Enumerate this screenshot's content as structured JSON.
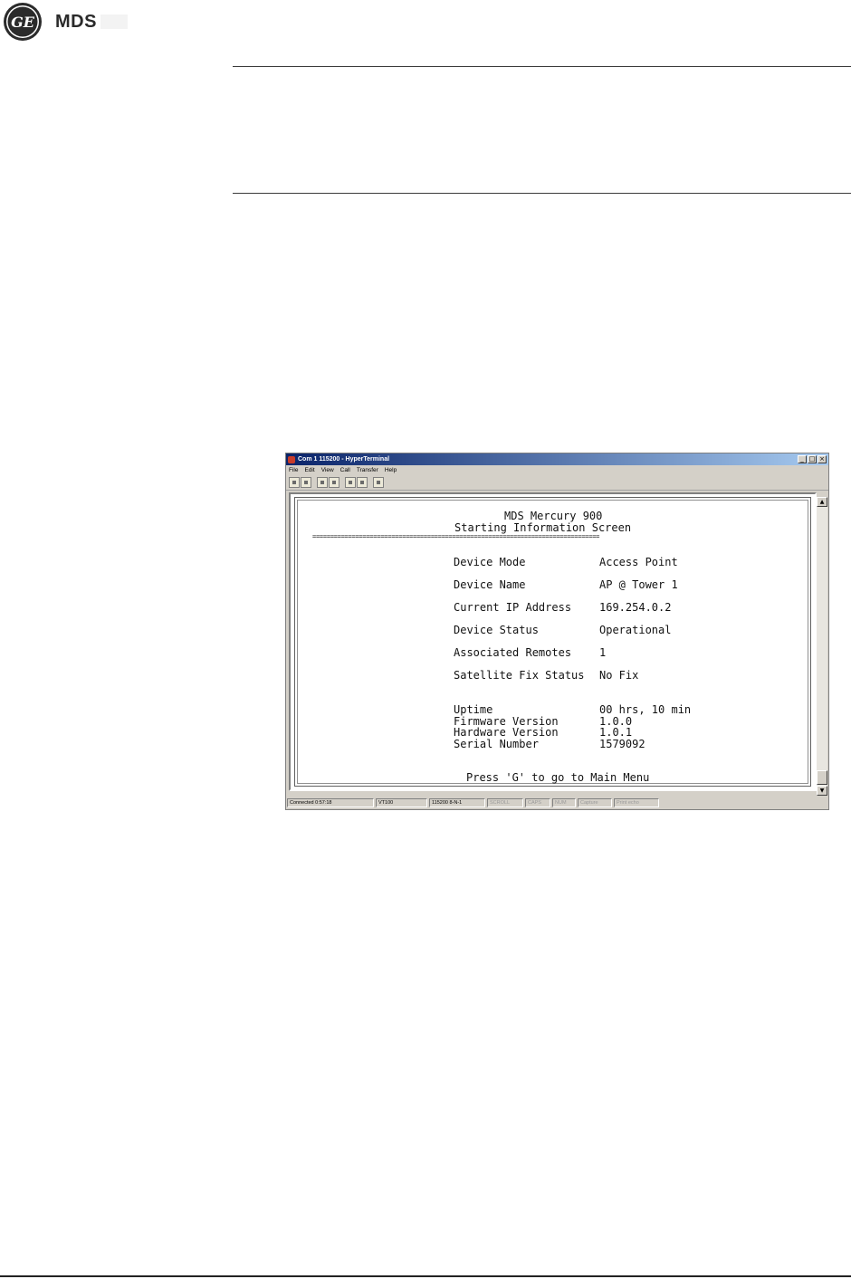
{
  "header": {
    "logo_brand": "MDS",
    "logo_seal_letters": "GE"
  },
  "window": {
    "title": "Com 1 115200 - HyperTerminal",
    "controls": [
      "_",
      "□",
      "×"
    ],
    "menu": [
      "File",
      "Edit",
      "View",
      "Call",
      "Transfer",
      "Help"
    ],
    "toolbar_icons": [
      "new-icon",
      "open-icon",
      "connect-icon",
      "disconnect-icon",
      "send-icon",
      "receive-icon",
      "properties-icon"
    ]
  },
  "terminal": {
    "title1": "MDS Mercury 900",
    "title2": "Starting Information Screen",
    "separator": "================================================================================",
    "fields": [
      {
        "label": "Device Mode",
        "value": "Access Point"
      },
      {
        "label": "Device Name",
        "value": "AP @ Tower 1"
      },
      {
        "label": "Current IP Address",
        "value": "169.254.0.2"
      },
      {
        "label": "Device Status",
        "value": "Operational"
      },
      {
        "label": "Associated Remotes",
        "value": "1"
      },
      {
        "label": "Satellite Fix Status",
        "value": "No Fix"
      }
    ],
    "info": [
      {
        "label": "Uptime",
        "value": "00 hrs, 10 min"
      },
      {
        "label": "Firmware Version",
        "value": "1.0.0"
      },
      {
        "label": "Hardware Version",
        "value": "1.0.1"
      },
      {
        "label": "Serial Number",
        "value": "1579092"
      }
    ],
    "prompt": "Press 'G' to go to Main Menu"
  },
  "statusbar": {
    "connected": "Connected 0:57:18",
    "emulation": "VT100",
    "settings": "115200 8-N-1",
    "scroll": "SCROLL",
    "caps": "CAPS",
    "num": "NUM",
    "capture": "Capture",
    "print_echo": "Print echo"
  }
}
